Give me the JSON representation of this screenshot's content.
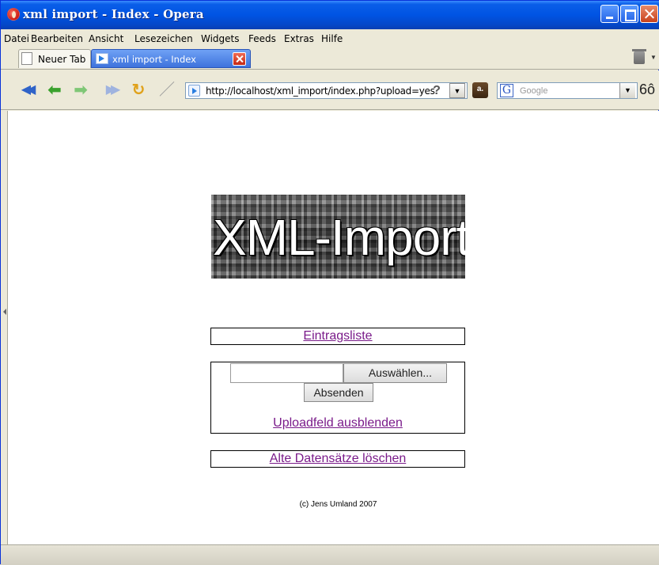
{
  "window": {
    "title": "xml import - Index - Opera"
  },
  "menu": {
    "items": [
      "Datei",
      "Bearbeiten",
      "Ansicht",
      "Lesezeichen",
      "Widgets",
      "Feeds",
      "Extras",
      "Hilfe"
    ]
  },
  "tabs": {
    "new_tab_label": "Neuer Tab",
    "active_tab_label": "xml import - Index"
  },
  "navigation": {
    "address": "http://localhost/xml_import/index.php?upload=yes",
    "help_glyph": "?",
    "search_placeholder": "Google",
    "search_engine_glyph": "G",
    "icons": [
      "rewind-icon",
      "back-icon",
      "forward-icon",
      "fast-forward-icon",
      "reload-icon",
      "edit-icon",
      "page-icon",
      "help-icon",
      "dropdown-icon",
      "search-engine-icon",
      "google-icon",
      "glasses-icon"
    ]
  },
  "page": {
    "banner_text": "XML-Import",
    "entries_link": "Eintragsliste",
    "browse_button": "Auswählen...",
    "submit_button": "Absenden",
    "hide_upload_link": "Uploadfeld ausblenden",
    "delete_old_link": "Alte Datensätze löschen",
    "credit": "(c) Jens Umland 2007"
  },
  "colors": {
    "link": "#7a1b8a",
    "titlebar": "#0054e3"
  }
}
